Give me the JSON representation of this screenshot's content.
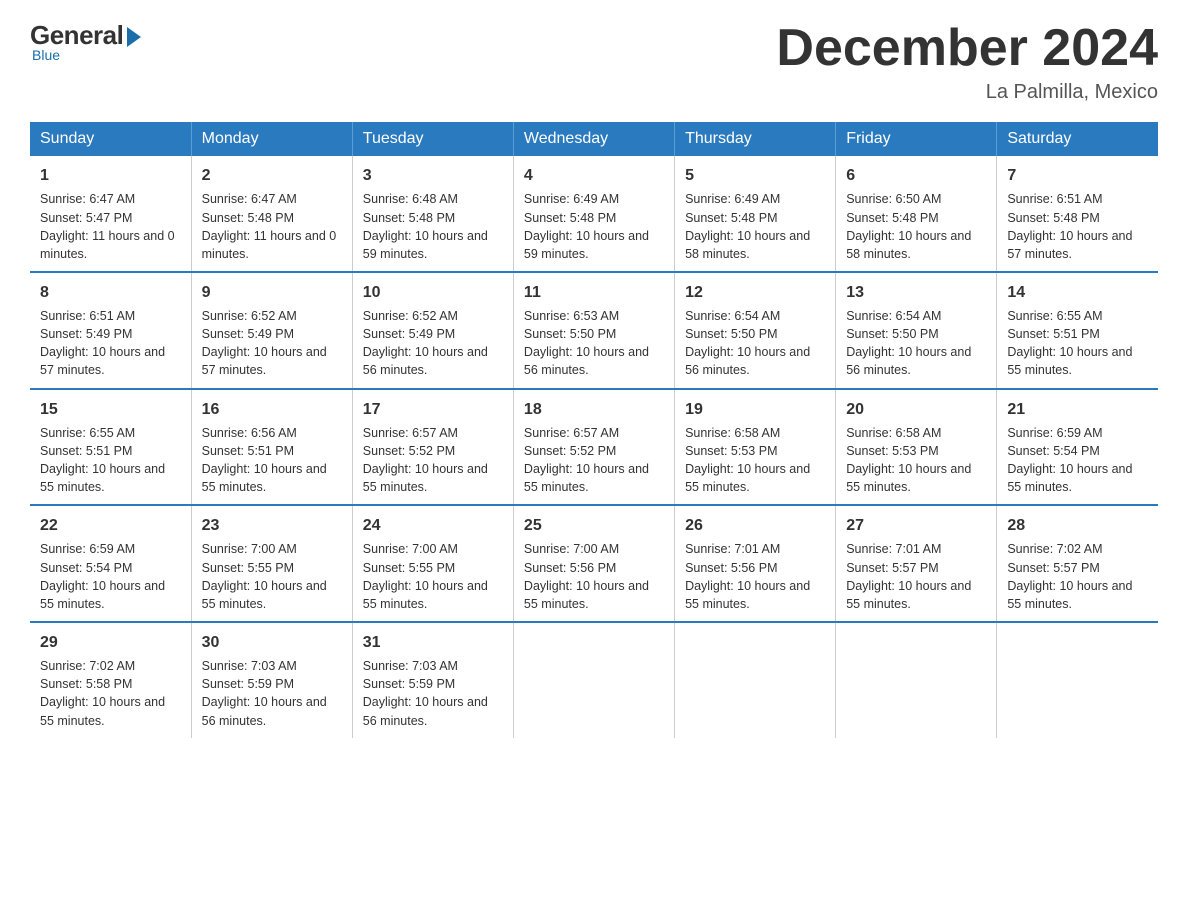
{
  "logo": {
    "general": "General",
    "blue": "Blue",
    "tagline": "Blue"
  },
  "header": {
    "month": "December 2024",
    "location": "La Palmilla, Mexico"
  },
  "weekdays": [
    "Sunday",
    "Monday",
    "Tuesday",
    "Wednesday",
    "Thursday",
    "Friday",
    "Saturday"
  ],
  "weeks": [
    [
      {
        "day": "1",
        "sunrise": "6:47 AM",
        "sunset": "5:47 PM",
        "daylight": "11 hours and 0 minutes."
      },
      {
        "day": "2",
        "sunrise": "6:47 AM",
        "sunset": "5:48 PM",
        "daylight": "11 hours and 0 minutes."
      },
      {
        "day": "3",
        "sunrise": "6:48 AM",
        "sunset": "5:48 PM",
        "daylight": "10 hours and 59 minutes."
      },
      {
        "day": "4",
        "sunrise": "6:49 AM",
        "sunset": "5:48 PM",
        "daylight": "10 hours and 59 minutes."
      },
      {
        "day": "5",
        "sunrise": "6:49 AM",
        "sunset": "5:48 PM",
        "daylight": "10 hours and 58 minutes."
      },
      {
        "day": "6",
        "sunrise": "6:50 AM",
        "sunset": "5:48 PM",
        "daylight": "10 hours and 58 minutes."
      },
      {
        "day": "7",
        "sunrise": "6:51 AM",
        "sunset": "5:48 PM",
        "daylight": "10 hours and 57 minutes."
      }
    ],
    [
      {
        "day": "8",
        "sunrise": "6:51 AM",
        "sunset": "5:49 PM",
        "daylight": "10 hours and 57 minutes."
      },
      {
        "day": "9",
        "sunrise": "6:52 AM",
        "sunset": "5:49 PM",
        "daylight": "10 hours and 57 minutes."
      },
      {
        "day": "10",
        "sunrise": "6:52 AM",
        "sunset": "5:49 PM",
        "daylight": "10 hours and 56 minutes."
      },
      {
        "day": "11",
        "sunrise": "6:53 AM",
        "sunset": "5:50 PM",
        "daylight": "10 hours and 56 minutes."
      },
      {
        "day": "12",
        "sunrise": "6:54 AM",
        "sunset": "5:50 PM",
        "daylight": "10 hours and 56 minutes."
      },
      {
        "day": "13",
        "sunrise": "6:54 AM",
        "sunset": "5:50 PM",
        "daylight": "10 hours and 56 minutes."
      },
      {
        "day": "14",
        "sunrise": "6:55 AM",
        "sunset": "5:51 PM",
        "daylight": "10 hours and 55 minutes."
      }
    ],
    [
      {
        "day": "15",
        "sunrise": "6:55 AM",
        "sunset": "5:51 PM",
        "daylight": "10 hours and 55 minutes."
      },
      {
        "day": "16",
        "sunrise": "6:56 AM",
        "sunset": "5:51 PM",
        "daylight": "10 hours and 55 minutes."
      },
      {
        "day": "17",
        "sunrise": "6:57 AM",
        "sunset": "5:52 PM",
        "daylight": "10 hours and 55 minutes."
      },
      {
        "day": "18",
        "sunrise": "6:57 AM",
        "sunset": "5:52 PM",
        "daylight": "10 hours and 55 minutes."
      },
      {
        "day": "19",
        "sunrise": "6:58 AM",
        "sunset": "5:53 PM",
        "daylight": "10 hours and 55 minutes."
      },
      {
        "day": "20",
        "sunrise": "6:58 AM",
        "sunset": "5:53 PM",
        "daylight": "10 hours and 55 minutes."
      },
      {
        "day": "21",
        "sunrise": "6:59 AM",
        "sunset": "5:54 PM",
        "daylight": "10 hours and 55 minutes."
      }
    ],
    [
      {
        "day": "22",
        "sunrise": "6:59 AM",
        "sunset": "5:54 PM",
        "daylight": "10 hours and 55 minutes."
      },
      {
        "day": "23",
        "sunrise": "7:00 AM",
        "sunset": "5:55 PM",
        "daylight": "10 hours and 55 minutes."
      },
      {
        "day": "24",
        "sunrise": "7:00 AM",
        "sunset": "5:55 PM",
        "daylight": "10 hours and 55 minutes."
      },
      {
        "day": "25",
        "sunrise": "7:00 AM",
        "sunset": "5:56 PM",
        "daylight": "10 hours and 55 minutes."
      },
      {
        "day": "26",
        "sunrise": "7:01 AM",
        "sunset": "5:56 PM",
        "daylight": "10 hours and 55 minutes."
      },
      {
        "day": "27",
        "sunrise": "7:01 AM",
        "sunset": "5:57 PM",
        "daylight": "10 hours and 55 minutes."
      },
      {
        "day": "28",
        "sunrise": "7:02 AM",
        "sunset": "5:57 PM",
        "daylight": "10 hours and 55 minutes."
      }
    ],
    [
      {
        "day": "29",
        "sunrise": "7:02 AM",
        "sunset": "5:58 PM",
        "daylight": "10 hours and 55 minutes."
      },
      {
        "day": "30",
        "sunrise": "7:03 AM",
        "sunset": "5:59 PM",
        "daylight": "10 hours and 56 minutes."
      },
      {
        "day": "31",
        "sunrise": "7:03 AM",
        "sunset": "5:59 PM",
        "daylight": "10 hours and 56 minutes."
      },
      null,
      null,
      null,
      null
    ]
  ]
}
